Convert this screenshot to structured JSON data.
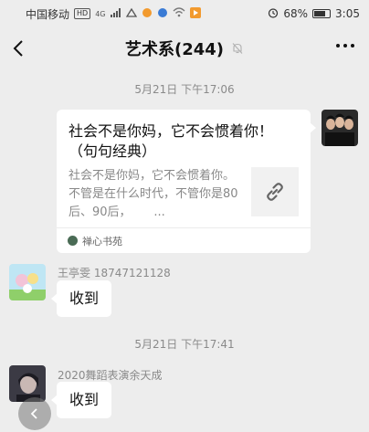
{
  "status_bar": {
    "carrier": "中国移动",
    "hd_badge": "HD",
    "network": "4G",
    "battery_percent": "68%",
    "time": "3:05",
    "battery_level": 0.68
  },
  "header": {
    "title": "艺术系(244)"
  },
  "messages": {
    "timestamp_1": "5月21日 下午17:06",
    "link_card": {
      "title": "社会不是你妈，它不会惯着你！（句句经典）",
      "description": "社会不是你妈，它不会惯着你。      不管是在什么时代，不管你是80后、90后，      ...",
      "source": "禅心书苑"
    },
    "msg_2": {
      "sender": "王亭雯  18747121128",
      "text": "收到"
    },
    "timestamp_2": "5月21日 下午17:41",
    "msg_3": {
      "sender": "2020舞蹈表演余天成",
      "text": "收到"
    }
  }
}
